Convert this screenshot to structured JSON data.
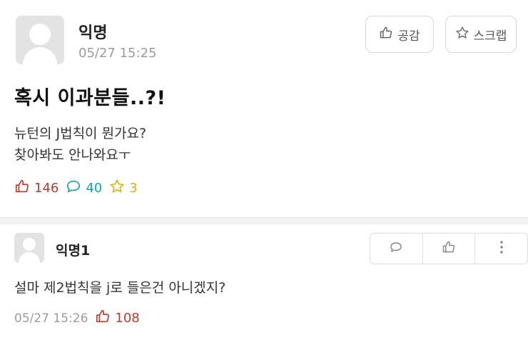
{
  "post": {
    "author": "익명",
    "time": "05/27 15:25",
    "like_button_label": "공감",
    "scrap_button_label": "스크랩",
    "title": "혹시 이과분들..?!",
    "body_lines": [
      "뉴턴의 J법칙이 뭔가요?",
      "찾아봐도 안나와요ㅜ"
    ],
    "stats": {
      "likes": "146",
      "comments": "40",
      "scraps": "3"
    }
  },
  "comment": {
    "author": "익명1",
    "text": "설마 제2법칙을 j로 들은건 아니겠지?",
    "time": "05/27 15:26",
    "likes": "108"
  },
  "colors": {
    "like": "#c0392b",
    "comment": "#0ca5b0",
    "scrap": "#e5b200"
  },
  "icons": [
    "thumbs-up-icon",
    "star-icon",
    "speech-bubble-icon",
    "more-vertical-icon",
    "avatar-icon"
  ]
}
